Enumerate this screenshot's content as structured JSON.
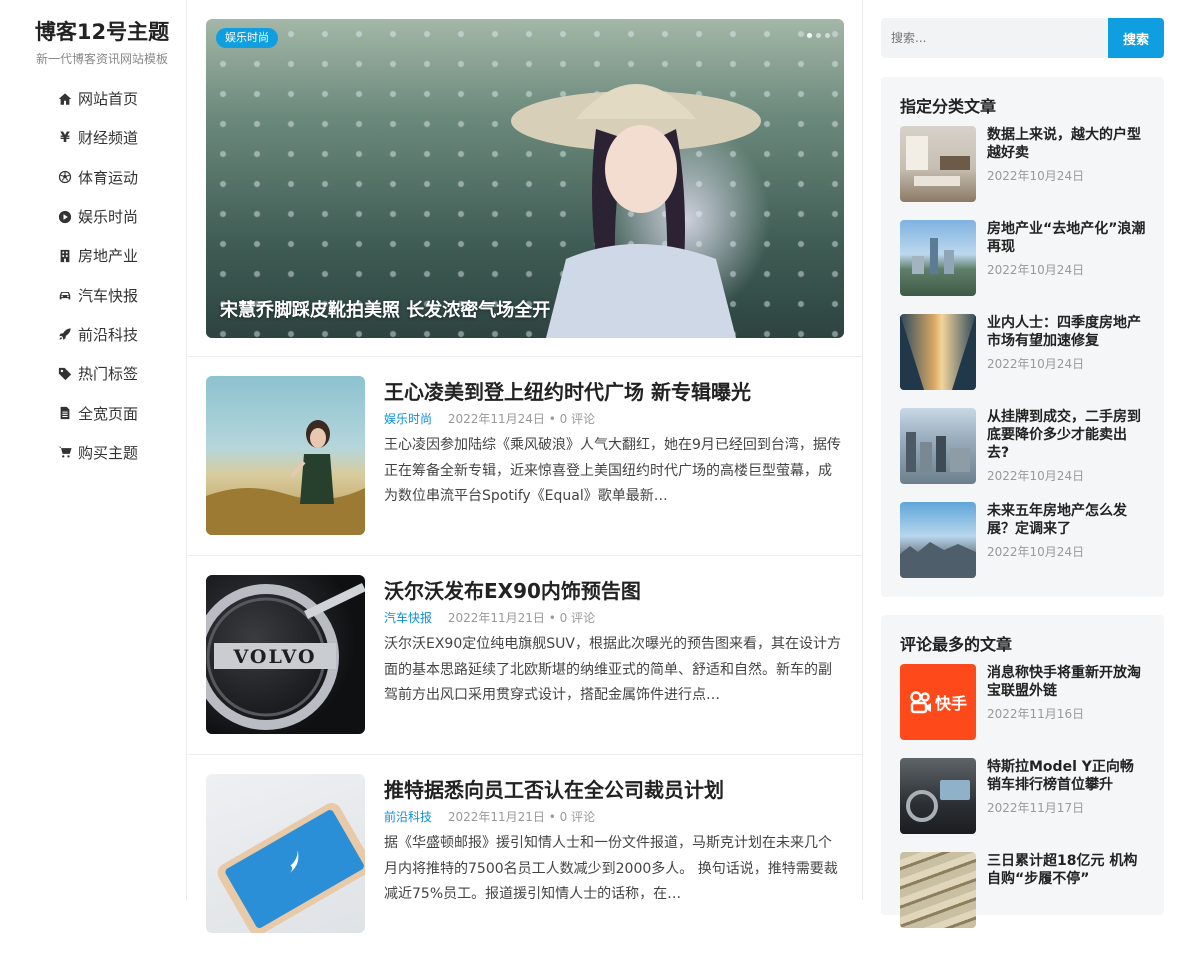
{
  "site": {
    "title": "博客12号主题",
    "subtitle": "新一代博客资讯网站模板"
  },
  "nav": [
    {
      "label": "网站首页",
      "icon": "home-icon",
      "active": true
    },
    {
      "label": "财经频道",
      "icon": "yen-icon"
    },
    {
      "label": "体育运动",
      "icon": "soccer-ball-icon"
    },
    {
      "label": "娱乐时尚",
      "icon": "play-circle-icon"
    },
    {
      "label": "房地产业",
      "icon": "building-icon"
    },
    {
      "label": "汽车快报",
      "icon": "car-icon"
    },
    {
      "label": "前沿科技",
      "icon": "rocket-icon"
    },
    {
      "label": "热门标签",
      "icon": "tag-icon"
    },
    {
      "label": "全宽页面",
      "icon": "document-icon"
    },
    {
      "label": "购买主题",
      "icon": "cart-icon"
    }
  ],
  "hero": {
    "badge": "娱乐时尚",
    "title": "宋慧乔脚踩皮靴拍美照 长发浓密气场全开",
    "slides": 3,
    "active_slide": 1
  },
  "posts": [
    {
      "title": "王心凌美到登上纽约时代广场 新专辑曝光",
      "category": "娱乐时尚",
      "date": "2022年11月24日",
      "comments": "0 评论",
      "excerpt": "王心凌因参加陆综《乘风破浪》人气大翻红，她在9月已经回到台湾，据传正在筹备全新专辑，近来惊喜登上美国纽约时代广场的高楼巨型萤幕，成为数位串流平台Spotify《Equal》歌单最新…"
    },
    {
      "title": "沃尔沃发布EX90内饰预告图",
      "category": "汽车快报",
      "date": "2022年11月21日",
      "comments": "0 评论",
      "excerpt": "沃尔沃EX90定位纯电旗舰SUV，根据此次曝光的预告图来看，其在设计方面的基本思路延续了北欧斯堪的纳维亚式的简单、舒适和自然。新车的副驾前方出风口采用贯穿式设计，搭配金属饰件进行点…",
      "thumb_text": "VOLVO"
    },
    {
      "title": "推特据悉向员工否认在全公司裁员计划",
      "category": "前沿科技",
      "date": "2022年11月21日",
      "comments": "0 评论",
      "excerpt": "据《华盛顿邮报》援引知情人士和一份文件报道，马斯克计划在未来几个月内将推特的7500名员工人数减少到2000多人。 换句话说，推特需要裁减近75%员工。报道援引知情人士的话称，在…"
    }
  ],
  "search": {
    "placeholder": "搜索...",
    "button": "搜索"
  },
  "widget1": {
    "title": "指定分类文章",
    "items": [
      {
        "title": "数据上来说，越大的户型越好卖",
        "date": "2022年10月24日"
      },
      {
        "title": "房地产业“去地产化”浪潮再现",
        "date": "2022年10月24日"
      },
      {
        "title": "业内人士：四季度房地产市场有望加速修复",
        "date": "2022年10月24日"
      },
      {
        "title": "从挂牌到成交，二手房到底要降价多少才能卖出去?",
        "date": "2022年10月24日"
      },
      {
        "title": "未来五年房地产怎么发展？定调来了",
        "date": "2022年10月24日"
      }
    ]
  },
  "widget2": {
    "title": "评论最多的文章",
    "items": [
      {
        "title": "消息称快手将重新开放淘宝联盟外链",
        "date": "2022年11月16日",
        "thumb_text": "快手"
      },
      {
        "title": "特斯拉Model Y正向畅销车排行榜首位攀升",
        "date": "2022年11月17日"
      },
      {
        "title": "三日累计超18亿元 机构自购“步履不停”",
        "date": ""
      }
    ]
  },
  "colors": {
    "accent": "#0f9fe0",
    "category": "#0f8fd8",
    "kuaishou": "#fe4a1a"
  }
}
